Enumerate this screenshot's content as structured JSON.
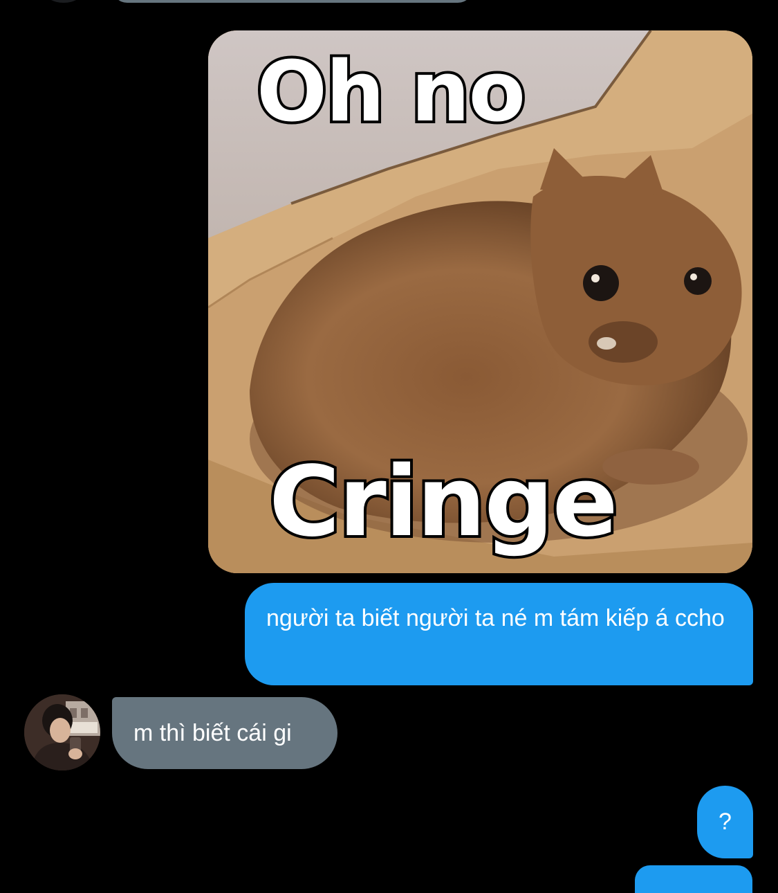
{
  "conversation": {
    "messages": [
      {
        "sender": "me",
        "type": "image",
        "caption_top": "Oh no",
        "caption_bottom": "Cringe"
      },
      {
        "sender": "me",
        "type": "text",
        "text": "người ta biết người ta né m tám kiếp á ccho"
      },
      {
        "sender": "other",
        "type": "text",
        "text": "m thì biết cái gi"
      },
      {
        "sender": "me",
        "type": "text",
        "text": "?"
      }
    ]
  },
  "colors": {
    "background": "#000000",
    "sent_bubble": "#1d9bf0",
    "received_bubble": "#66757f",
    "text": "#ffffff"
  },
  "icons": {
    "avatar": "user-avatar-photo"
  }
}
